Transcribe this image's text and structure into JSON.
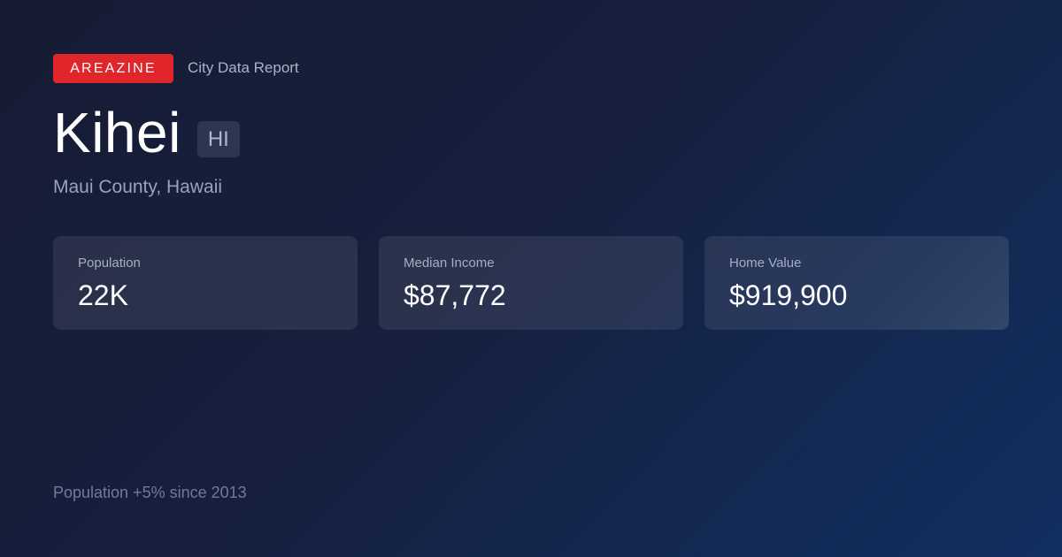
{
  "header": {
    "brand": "AREAZINE",
    "report_label": "City Data Report"
  },
  "location": {
    "city": "Kihei",
    "state_abbr": "HI",
    "county_state": "Maui County, Hawaii"
  },
  "stats": [
    {
      "label": "Population",
      "value": "22K"
    },
    {
      "label": "Median Income",
      "value": "$87,772"
    },
    {
      "label": "Home Value",
      "value": "$919,900"
    }
  ],
  "footnote": "Population +5% since 2013",
  "colors": {
    "brand_red": "#e0262a",
    "background_start": "#171c34",
    "background_end": "#112f60"
  }
}
